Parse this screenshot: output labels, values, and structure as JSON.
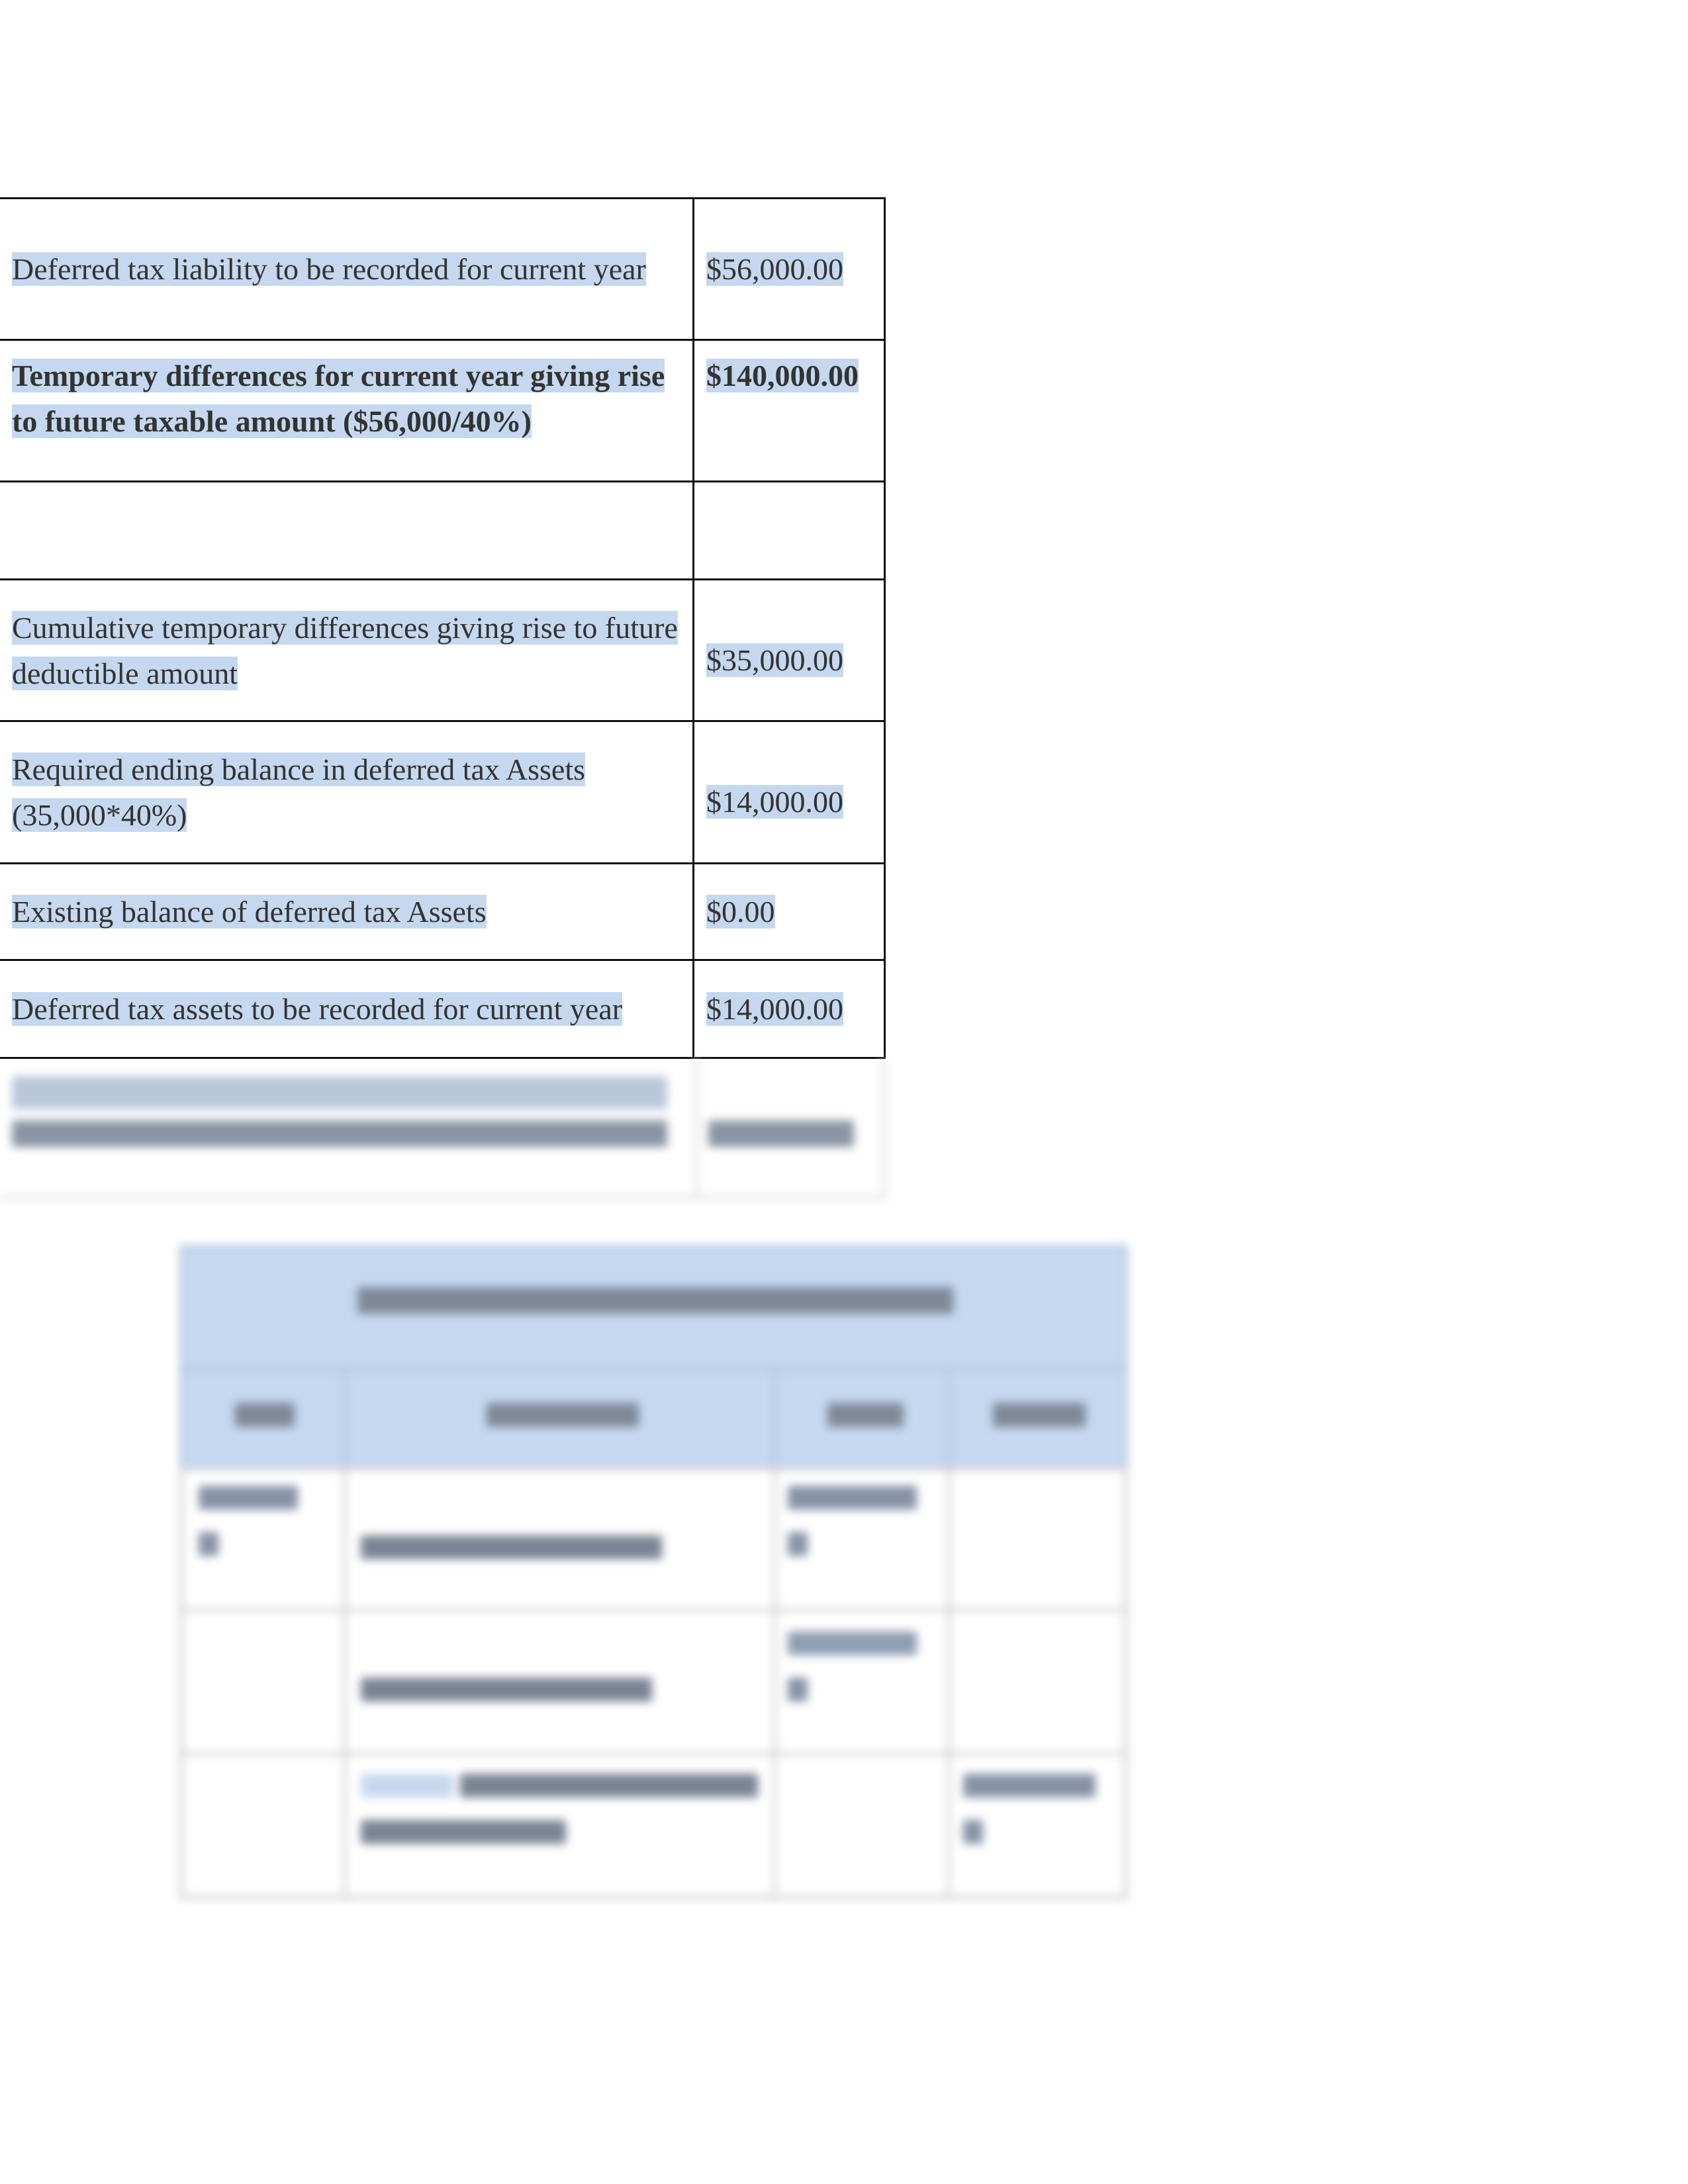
{
  "table": {
    "rows": [
      {
        "label": "Deferred tax liability to be recorded for current year",
        "value": "$56,000.00",
        "bold": false
      },
      {
        "label": "Temporary differences for current year giving rise to future taxable amount ($56,000/40%)",
        "value": "$140,000.00",
        "bold": true
      },
      {
        "label": "",
        "value": "",
        "bold": false
      },
      {
        "label": "Cumulative temporary differences giving rise to future deductible amount",
        "value": "$35,000.00",
        "bold": false
      },
      {
        "label": "Required ending balance in deferred tax Assets (35,000*40%)",
        "value": "$14,000.00",
        "bold": false
      },
      {
        "label": "Existing balance of deferred tax Assets",
        "value": "$0.00",
        "bold": false
      },
      {
        "label": "Deferred tax assets to be recorded for current year",
        "value": "$14,000.00",
        "bold": false
      }
    ]
  },
  "colors": {
    "highlight": "#c5d8ef",
    "header_fill": "#c5d8ef",
    "text": "#333333"
  }
}
